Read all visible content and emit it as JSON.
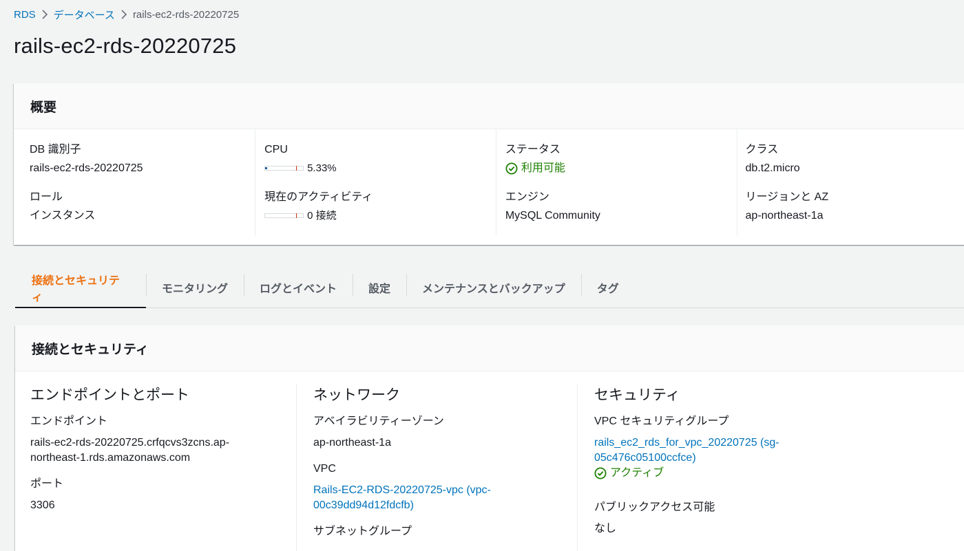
{
  "breadcrumb": {
    "root": "RDS",
    "databases": "データベース",
    "current": "rails-ec2-rds-20220725"
  },
  "page_title": "rails-ec2-rds-20220725",
  "summary": {
    "title": "概要",
    "db_identifier_label": "DB 識別子",
    "db_identifier": "rails-ec2-rds-20220725",
    "role_label": "ロール",
    "role": "インスタンス",
    "cpu_label": "CPU",
    "cpu_value": "5.33%",
    "cpu_fraction": 0.0533,
    "activity_label": "現在のアクティビティ",
    "activity_value": "0 接続",
    "activity_fraction": 0,
    "status_label": "ステータス",
    "status": "利用可能",
    "engine_label": "エンジン",
    "engine": "MySQL Community",
    "class_label": "クラス",
    "class": "db.t2.micro",
    "region_label": "リージョンと AZ",
    "region": "ap-northeast-1a"
  },
  "tabs": [
    {
      "label": "接続とセキュリティ",
      "active": true
    },
    {
      "label": "モニタリング",
      "active": false
    },
    {
      "label": "ログとイベント",
      "active": false
    },
    {
      "label": "設定",
      "active": false
    },
    {
      "label": "メンテナンスとバックアップ",
      "active": false
    },
    {
      "label": "タグ",
      "active": false
    }
  ],
  "connectivity": {
    "title": "接続とセキュリティ",
    "endpoint_section": {
      "title": "エンドポイントとポート",
      "endpoint_label": "エンドポイント",
      "endpoint": "rails-ec2-rds-20220725.crfqcvs3zcns.ap-northeast-1.rds.amazonaws.com",
      "port_label": "ポート",
      "port": "3306"
    },
    "network_section": {
      "title": "ネットワーク",
      "az_label": "アベイラビリティーゾーン",
      "az": "ap-northeast-1a",
      "vpc_label": "VPC",
      "vpc": "Rails-EC2-RDS-20220725-vpc (vpc-00c39dd94d12fdcfb)",
      "subnet_label": "サブネットグループ"
    },
    "security_section": {
      "title": "セキュリティ",
      "sg_label": "VPC セキュリティグループ",
      "sg": "rails_ec2_rds_for_vpc_20220725 (sg-05c476c05100ccfce)",
      "sg_status": "アクティブ",
      "public_label": "パブリックアクセス可能",
      "public": "なし"
    }
  },
  "colors": {
    "link": "#0073bb",
    "active_tab": "#ec7211",
    "success": "#1d8102",
    "background": "#f2f3f3"
  },
  "icons": [
    "chevron-right-icon",
    "status-check-icon"
  ]
}
